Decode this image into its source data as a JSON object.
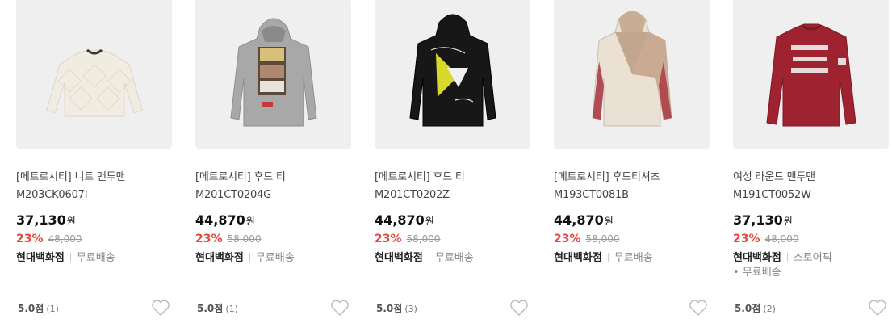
{
  "products": [
    {
      "title": "[메트로시티] 니트 맨투맨 M203CK0607I",
      "price": "37,130",
      "currency": "원",
      "discount": "23%",
      "original_price": "48,000",
      "seller": "현대백화점",
      "shipping": "무료배송",
      "extra": "",
      "rating": "5.0점",
      "review_count": "(1)",
      "image_icon": "knit-sweater-icon",
      "garment_color": "#f0ebe0"
    },
    {
      "title": "[메트로시티] 후드 티 M201CT0204G",
      "price": "44,870",
      "currency": "원",
      "discount": "23%",
      "original_price": "58,000",
      "seller": "현대백화점",
      "shipping": "무료배송",
      "extra": "",
      "rating": "5.0점",
      "review_count": "(1)",
      "image_icon": "gray-hoodie-icon",
      "garment_color": "#a6a6a6"
    },
    {
      "title": "[메트로시티] 후드 티 M201CT0202Z",
      "price": "44,870",
      "currency": "원",
      "discount": "23%",
      "original_price": "58,000",
      "seller": "현대백화점",
      "shipping": "무료배송",
      "extra": "",
      "rating": "5.0점",
      "review_count": "(3)",
      "image_icon": "black-hoodie-icon",
      "garment_color": "#161616"
    },
    {
      "title": "[메트로시티] 후드티셔츠 M193CT0081B",
      "price": "44,870",
      "currency": "원",
      "discount": "23%",
      "original_price": "58,000",
      "seller": "현대백화점",
      "shipping": "무료배송",
      "extra": "",
      "rating": "",
      "review_count": "",
      "image_icon": "colorblock-hoodie-icon",
      "garment_color": "#c9ab93"
    },
    {
      "title": "여성 라운드 맨투맨 M191CT0052W",
      "price": "37,130",
      "currency": "원",
      "discount": "23%",
      "original_price": "48,000",
      "seller": "현대백화점",
      "shipping": "스토어픽",
      "extra": "• 무료배송",
      "rating": "5.0점",
      "review_count": "(2)",
      "image_icon": "red-sweatshirt-icon",
      "garment_color": "#9c2230"
    }
  ],
  "colors": {
    "discount": "#e8473b",
    "thumb_bg": "#efefef"
  }
}
